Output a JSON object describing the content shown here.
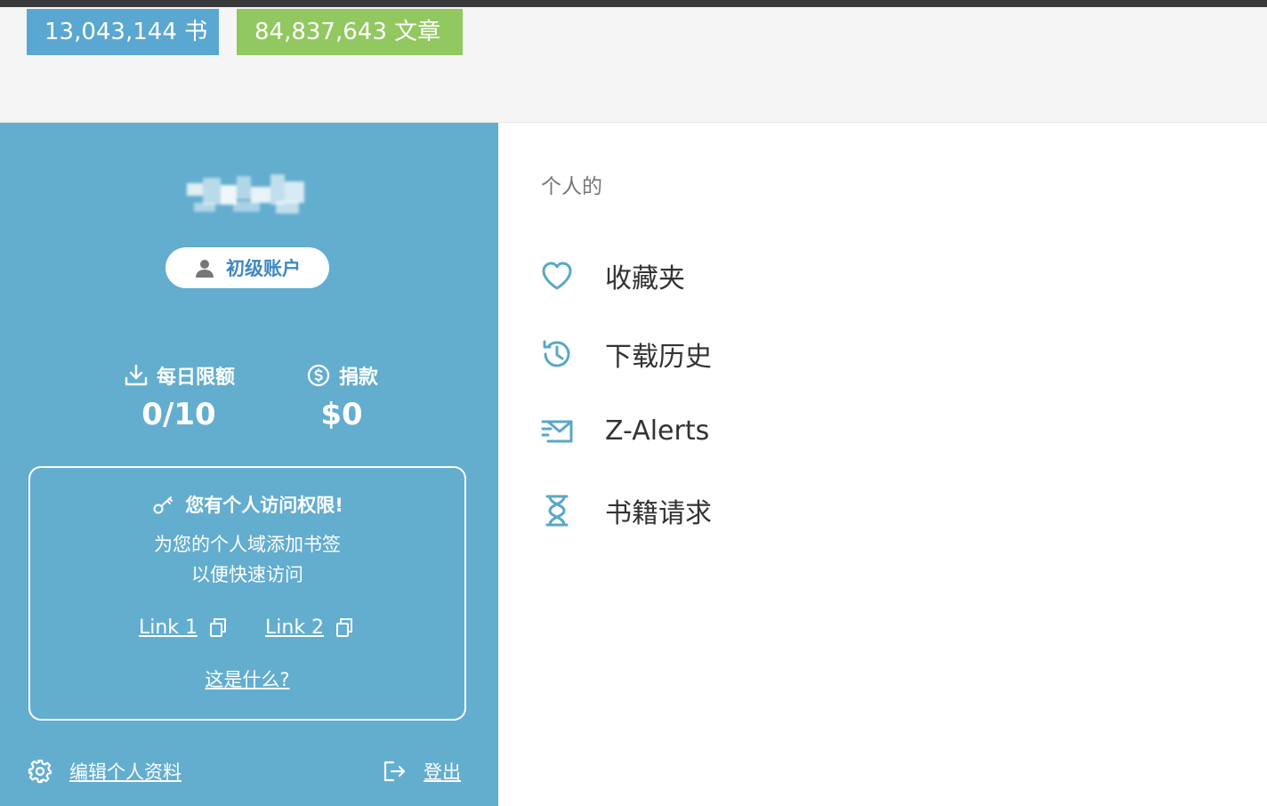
{
  "header": {
    "books_stat": "13,043,144 书",
    "articles_stat": "84,837,643 文章",
    "books_color": "#5aa7d2",
    "articles_color": "#92c860"
  },
  "sidebar": {
    "account_type": "初级账户",
    "daily_limit_label": "每日限额",
    "daily_limit_value": "0/10",
    "donate_label": "捐款",
    "donate_value": "$0",
    "access_box": {
      "title": "您有个人访问权限!",
      "line1": "为您的个人域添加书签",
      "line2": "以便快速访问",
      "link1": "Link 1",
      "link2": "Link 2",
      "whats_this": "这是什么?"
    },
    "edit_profile": "编辑个人资料",
    "logout": "登出",
    "background_color": "#63adcf"
  },
  "main": {
    "section_title": "个人的",
    "items": [
      {
        "label": "收藏夹",
        "icon": "heart-icon"
      },
      {
        "label": "下载历史",
        "icon": "history-icon"
      },
      {
        "label": "Z-Alerts",
        "icon": "mail-alert-icon"
      },
      {
        "label": "书籍请求",
        "icon": "hourglass-icon"
      }
    ],
    "icon_color": "#5aa7c9"
  }
}
